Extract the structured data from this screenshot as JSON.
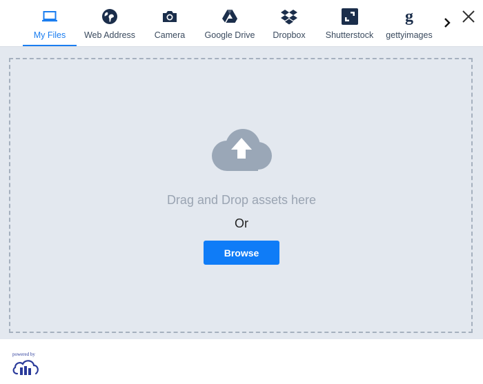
{
  "tabs": [
    {
      "label": "My Files",
      "icon": "laptop-icon",
      "active": true
    },
    {
      "label": "Web Address",
      "icon": "globe-icon",
      "active": false
    },
    {
      "label": "Camera",
      "icon": "camera-icon",
      "active": false
    },
    {
      "label": "Google Drive",
      "icon": "google-drive-icon",
      "active": false
    },
    {
      "label": "Dropbox",
      "icon": "dropbox-icon",
      "active": false
    },
    {
      "label": "Shutterstock",
      "icon": "shutterstock-icon",
      "active": false
    },
    {
      "label": "gettyimages",
      "icon": "gettyimages-icon",
      "active": false
    }
  ],
  "dropzone": {
    "hint": "Drag and Drop assets here",
    "or": "Or",
    "browse_label": "Browse"
  },
  "footer": {
    "powered_by": "powered by"
  },
  "colors": {
    "accent": "#1a7df0",
    "button": "#0f7cf7",
    "icon_dark": "#1b2e4b",
    "dropzone_bg": "#e3e8ef"
  }
}
